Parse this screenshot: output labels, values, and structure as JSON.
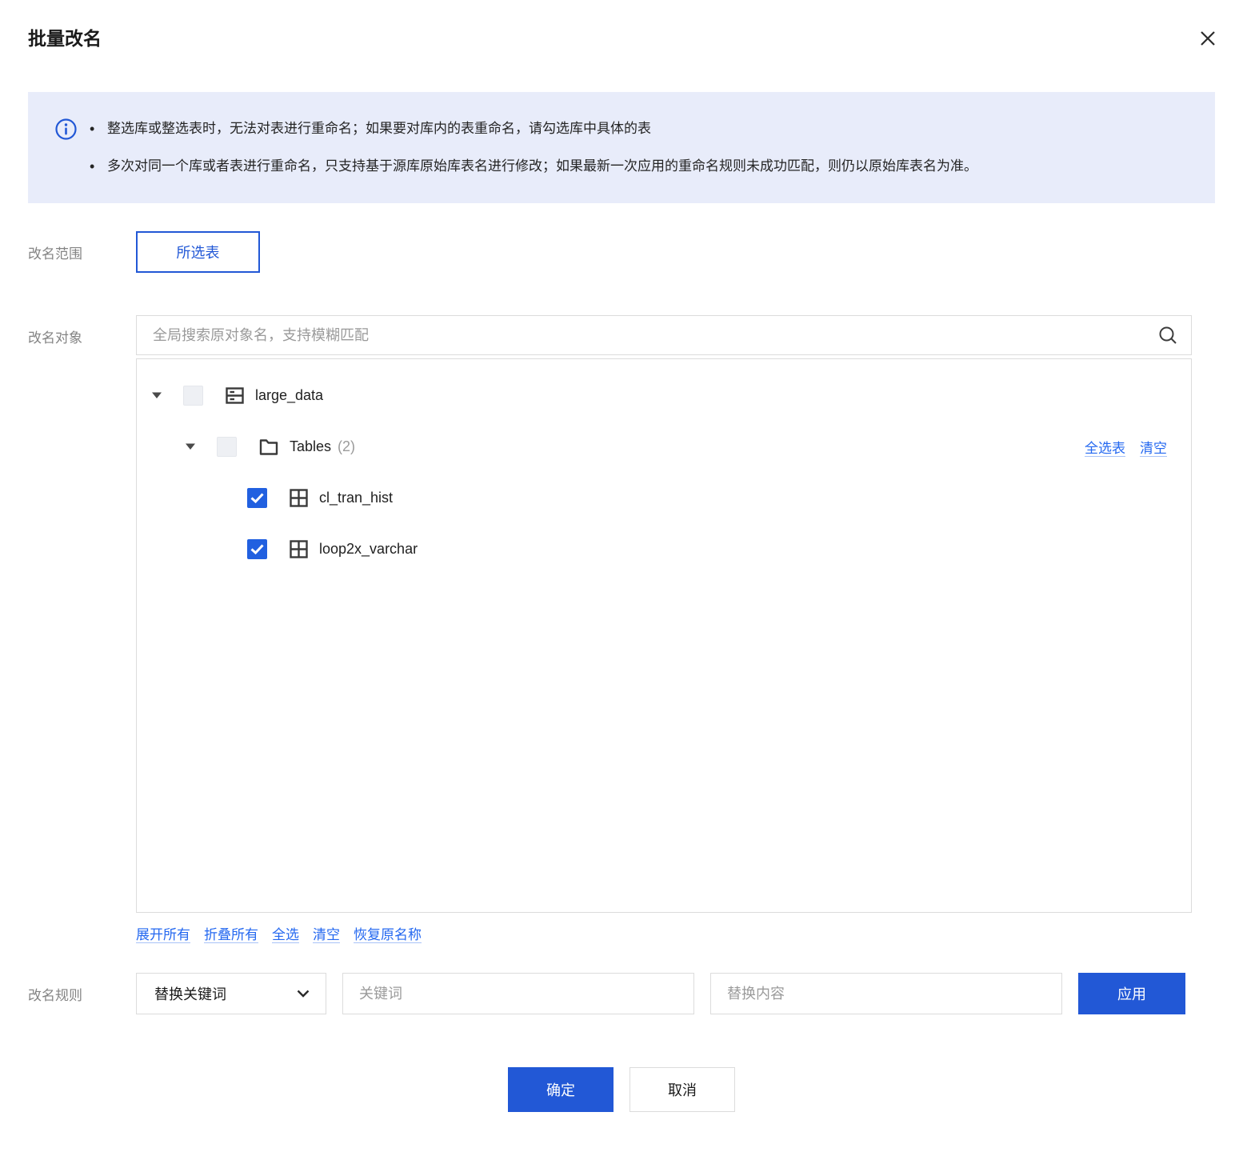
{
  "dialog": {
    "title": "批量改名"
  },
  "banner": {
    "bullets": [
      "整选库或整选表时，无法对表进行重命名；如果要对库内的表重命名，请勾选库中具体的表",
      "多次对同一个库或者表进行重命名，只支持基于源库原始库表名进行修改；如果最新一次应用的重命名规则未成功匹配，则仍以原始库表名为准。"
    ]
  },
  "scope": {
    "label": "改名范围",
    "selected_option": "所选表"
  },
  "objects": {
    "label": "改名对象",
    "search_placeholder": "全局搜索原对象名，支持模糊匹配",
    "tree": {
      "database": {
        "name": "large_data",
        "checked": false,
        "expanded": true
      },
      "tables_group": {
        "label": "Tables",
        "count": "(2)",
        "checked": false,
        "expanded": true,
        "select_all_label": "全选表",
        "clear_label": "清空"
      },
      "tables": [
        {
          "name": "cl_tran_hist",
          "checked": true
        },
        {
          "name": "loop2x_varchar",
          "checked": true
        }
      ]
    },
    "actions": [
      "展开所有",
      "折叠所有",
      "全选",
      "清空",
      "恢复原名称"
    ]
  },
  "rule": {
    "label": "改名规则",
    "type_selected": "替换关键词",
    "keyword_placeholder": "关键词",
    "replacement_placeholder": "替换内容",
    "apply_label": "应用"
  },
  "footer": {
    "ok_label": "确定",
    "cancel_label": "取消"
  },
  "colors": {
    "primary": "#2258d6",
    "checkbox_checked": "#2160e0",
    "link": "#2468f0",
    "banner_background": "#e8ecfa"
  }
}
